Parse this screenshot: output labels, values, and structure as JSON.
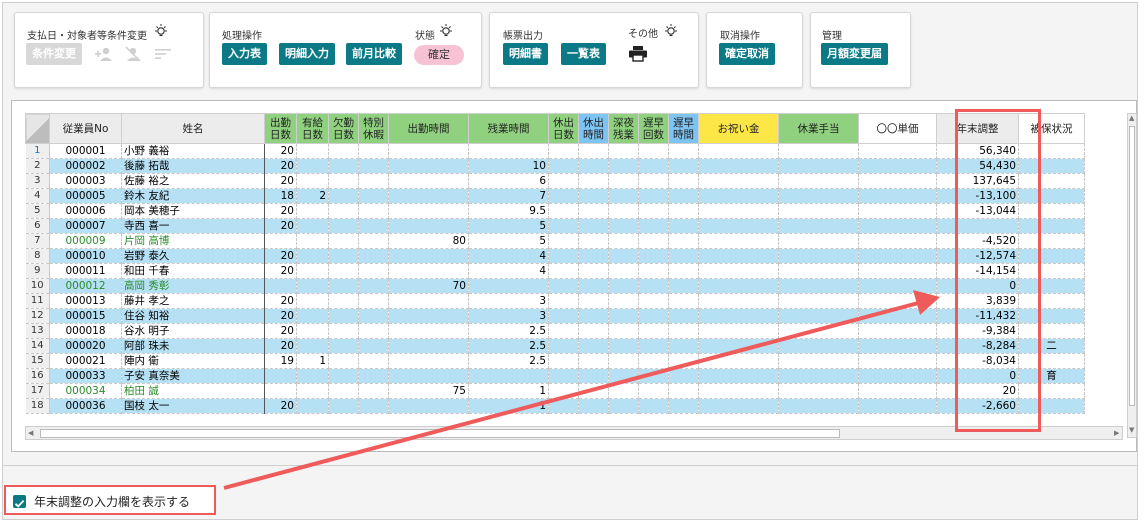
{
  "toolbar": {
    "payment": {
      "label": "支払日・対象者等条件変更",
      "btn": "条件変更"
    },
    "process": {
      "label": "処理操作",
      "state_label": "状態",
      "btns": [
        "入力表",
        "明細入力",
        "前月比較"
      ],
      "state": "確定"
    },
    "report": {
      "label": "帳票出力",
      "other_label": "その他",
      "btns": [
        "明細書",
        "一覧表"
      ]
    },
    "cancel": {
      "label": "取消操作",
      "btn": "確定取消"
    },
    "manage": {
      "label": "管理",
      "btn": "月額変更届"
    }
  },
  "table": {
    "headers": {
      "emp_no": "従業員No",
      "name": "姓名",
      "work_days": [
        "出勤",
        "日数"
      ],
      "paid_leave": [
        "有給",
        "日数"
      ],
      "absent": [
        "欠勤",
        "日数"
      ],
      "special": [
        "特別",
        "休暇"
      ],
      "work_time": "出勤時間",
      "overtime": "残業時間",
      "holiday_days": [
        "休出",
        "日数"
      ],
      "holiday_time": [
        "休出",
        "時間"
      ],
      "late_night": [
        "深夜",
        "残業"
      ],
      "late_count": [
        "遅早",
        "回数"
      ],
      "late_time": [
        "遅早",
        "時間"
      ],
      "celebration": "お祝い金",
      "leave_allow": "休業手当",
      "unit": "〇〇単価",
      "year_end": "年末調整",
      "insured": "被保状況"
    },
    "rows": [
      {
        "n": "1",
        "no": "000001",
        "name": "小野 義裕",
        "wd": "20",
        "pl": "",
        "wt": "",
        "ot": "",
        "ye": "56,340",
        "ins": "",
        "c": "white",
        "g": false
      },
      {
        "n": "2",
        "no": "000002",
        "name": "後藤 拓哉",
        "wd": "20",
        "pl": "",
        "wt": "",
        "ot": "10",
        "ye": "54,430",
        "ins": "",
        "c": "blue",
        "g": false
      },
      {
        "n": "3",
        "no": "000003",
        "name": "佐藤 裕之",
        "wd": "20",
        "pl": "",
        "wt": "",
        "ot": "6",
        "ye": "137,645",
        "ins": "",
        "c": "white",
        "g": false
      },
      {
        "n": "4",
        "no": "000005",
        "name": "鈴木 友紀",
        "wd": "18",
        "pl": "2",
        "wt": "",
        "ot": "7",
        "ye": "-13,100",
        "ins": "",
        "c": "blue",
        "g": false
      },
      {
        "n": "5",
        "no": "000006",
        "name": "岡本 美穂子",
        "wd": "20",
        "pl": "",
        "wt": "",
        "ot": "9.5",
        "ye": "-13,044",
        "ins": "",
        "c": "white",
        "g": false
      },
      {
        "n": "6",
        "no": "000007",
        "name": "寺西 喜一",
        "wd": "20",
        "pl": "",
        "wt": "",
        "ot": "5",
        "ye": "",
        "ins": "",
        "c": "blue",
        "g": false
      },
      {
        "n": "7",
        "no": "000009",
        "name": "片岡 高博",
        "wd": "",
        "pl": "",
        "wt": "80",
        "ot": "5",
        "ye": "-4,520",
        "ins": "",
        "c": "white",
        "g": true
      },
      {
        "n": "8",
        "no": "000010",
        "name": "岩野 泰久",
        "wd": "20",
        "pl": "",
        "wt": "",
        "ot": "4",
        "ye": "-12,574",
        "ins": "",
        "c": "blue",
        "g": false
      },
      {
        "n": "9",
        "no": "000011",
        "name": "和田 千春",
        "wd": "20",
        "pl": "",
        "wt": "",
        "ot": "4",
        "ye": "-14,154",
        "ins": "",
        "c": "white",
        "g": false
      },
      {
        "n": "10",
        "no": "000012",
        "name": "高岡 秀彰",
        "wd": "",
        "pl": "",
        "wt": "70",
        "ot": "",
        "ye": "0",
        "ins": "",
        "c": "blue",
        "g": true
      },
      {
        "n": "11",
        "no": "000013",
        "name": "藤井 孝之",
        "wd": "20",
        "pl": "",
        "wt": "",
        "ot": "3",
        "ye": "3,839",
        "ins": "",
        "c": "white",
        "g": false
      },
      {
        "n": "12",
        "no": "000015",
        "name": "住谷 知裕",
        "wd": "20",
        "pl": "",
        "wt": "",
        "ot": "3",
        "ye": "-11,432",
        "ins": "",
        "c": "blue",
        "g": false
      },
      {
        "n": "13",
        "no": "000018",
        "name": "谷水 明子",
        "wd": "20",
        "pl": "",
        "wt": "",
        "ot": "2.5",
        "ye": "-9,384",
        "ins": "",
        "c": "white",
        "g": false
      },
      {
        "n": "14",
        "no": "000020",
        "name": "阿部 珠未",
        "wd": "20",
        "pl": "",
        "wt": "",
        "ot": "2.5",
        "ye": "-8,284",
        "ins": "二",
        "c": "blue",
        "g": false
      },
      {
        "n": "15",
        "no": "000021",
        "name": "陣内 衛",
        "wd": "19",
        "pl": "1",
        "wt": "",
        "ot": "2.5",
        "ye": "-8,034",
        "ins": "",
        "c": "white",
        "g": false
      },
      {
        "n": "16",
        "no": "000033",
        "name": "子安 真奈美",
        "wd": "",
        "pl": "",
        "wt": "",
        "ot": "",
        "ye": "0",
        "ins": "育",
        "c": "blue",
        "g": false
      },
      {
        "n": "17",
        "no": "000034",
        "name": "柏田 誠",
        "wd": "",
        "pl": "",
        "wt": "75",
        "ot": "1",
        "ye": "20",
        "ins": "",
        "c": "white",
        "g": true
      },
      {
        "n": "18",
        "no": "000036",
        "name": "国枝 太一",
        "wd": "20",
        "pl": "",
        "wt": "",
        "ot": "1",
        "ye": "-2,660",
        "ins": "",
        "c": "blue",
        "g": false
      }
    ]
  },
  "checkbox": {
    "label": "年末調整の入力欄を表示する",
    "checked": true
  },
  "colors": {
    "teal": "#0b7a86",
    "highlight": "#ef5b5b",
    "row_blue": "#b6e0f4",
    "header_green": "#8fd17f",
    "header_blue": "#7ec4f2",
    "header_yellow": "#fde747",
    "state_pink": "#f7c2d4"
  }
}
